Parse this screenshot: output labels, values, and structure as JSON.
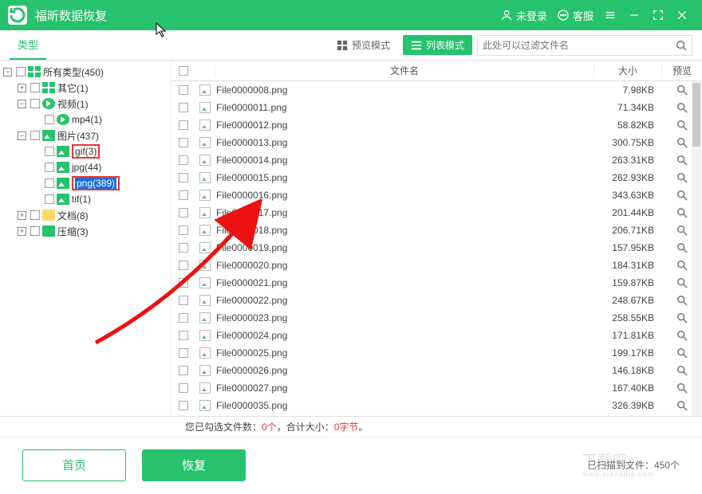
{
  "titlebar": {
    "app_name": "福昕数据恢复",
    "login": "未登录",
    "support": "客服"
  },
  "toolbar": {
    "tab_type": "类型",
    "view_preview": "预览模式",
    "view_list": "列表模式",
    "filter_placeholder": "此处可以过滤文件名"
  },
  "tree": {
    "all": "所有类型(450)",
    "misc": "其它(1)",
    "video": "视频(1)",
    "mp4": "mp4(1)",
    "image": "图片(437)",
    "gif": "gif(3)",
    "jpg": "jpg(44)",
    "png": "png(389)",
    "tif": "tif(1)",
    "doc": "文档(8)",
    "arc": "压缩(3)"
  },
  "columns": {
    "name": "文件名",
    "size": "大小",
    "preview": "预览"
  },
  "files": [
    {
      "name": "File0000008.png",
      "size": "7.98KB"
    },
    {
      "name": "File0000011.png",
      "size": "71.34KB"
    },
    {
      "name": "File0000012.png",
      "size": "58.82KB"
    },
    {
      "name": "File0000013.png",
      "size": "300.75KB"
    },
    {
      "name": "File0000014.png",
      "size": "263.31KB"
    },
    {
      "name": "File0000015.png",
      "size": "262.93KB"
    },
    {
      "name": "File0000016.png",
      "size": "343.63KB"
    },
    {
      "name": "File0000017.png",
      "size": "201.44KB"
    },
    {
      "name": "File0000018.png",
      "size": "206.71KB"
    },
    {
      "name": "File0000019.png",
      "size": "157.95KB"
    },
    {
      "name": "File0000020.png",
      "size": "184.31KB"
    },
    {
      "name": "File0000021.png",
      "size": "159.87KB"
    },
    {
      "name": "File0000022.png",
      "size": "248.67KB"
    },
    {
      "name": "File0000023.png",
      "size": "258.55KB"
    },
    {
      "name": "File0000024.png",
      "size": "171.81KB"
    },
    {
      "name": "File0000025.png",
      "size": "199.17KB"
    },
    {
      "name": "File0000026.png",
      "size": "146.18KB"
    },
    {
      "name": "File0000027.png",
      "size": "167.40KB"
    },
    {
      "name": "File0000035.png",
      "size": "326.39KB"
    }
  ],
  "status": {
    "prefix": "您已勾选文件数：",
    "count": "0个",
    "mid": "，合计大小：",
    "bytes": "0字节",
    "suffix": "。"
  },
  "bottom": {
    "home": "首页",
    "recover": "恢复",
    "scanned": "已扫描到文件：450个"
  },
  "watermark": {
    "main": "下载吧",
    "sub": "www.xiazaiba.com"
  }
}
